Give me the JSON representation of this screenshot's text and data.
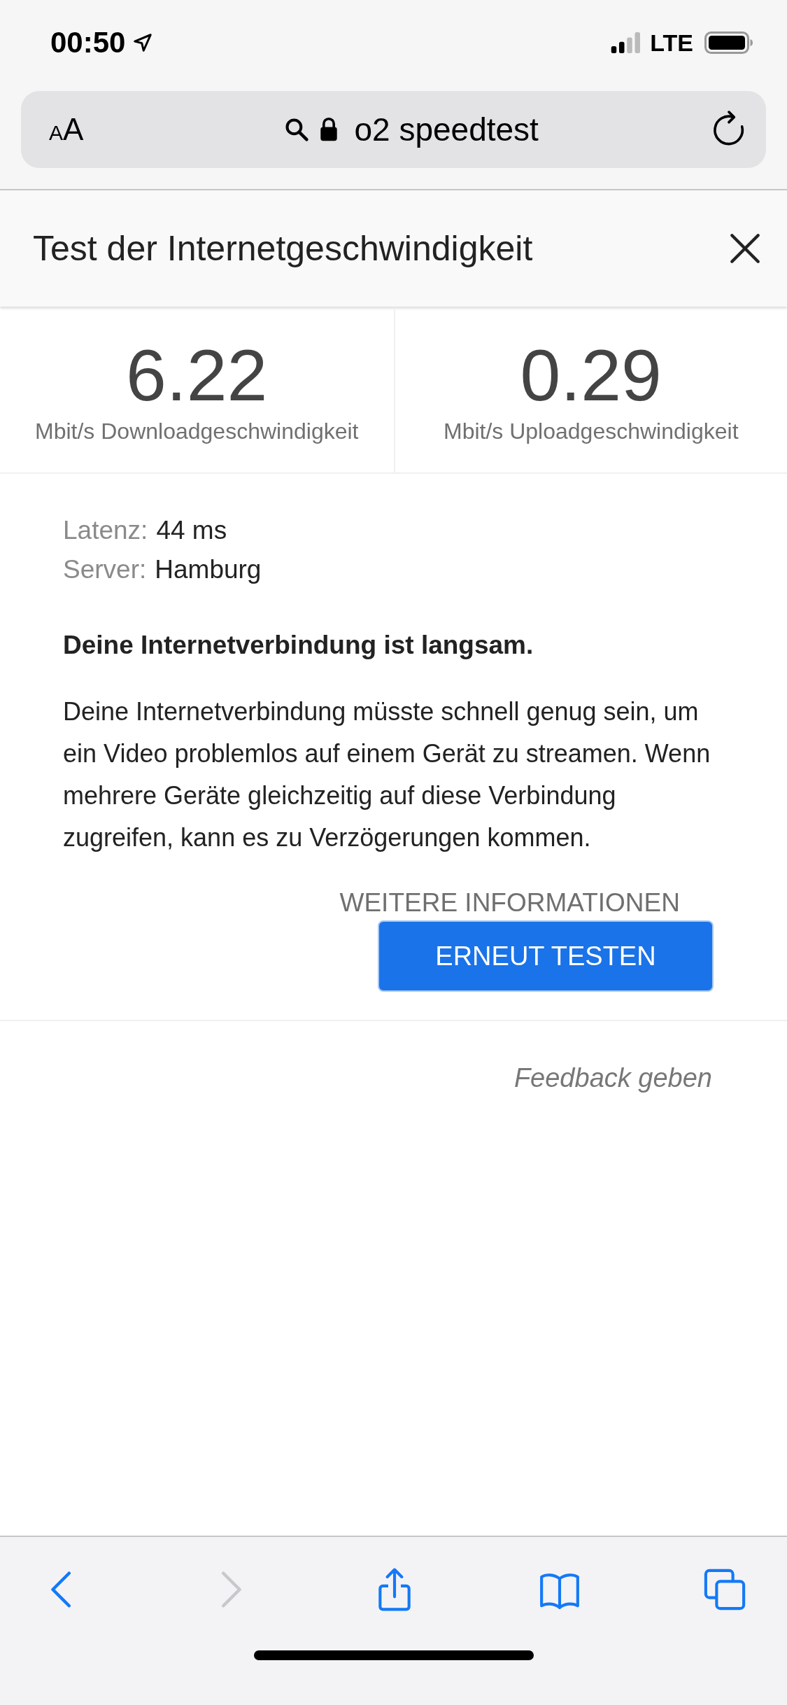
{
  "status_bar": {
    "time": "00:50",
    "network": "LTE"
  },
  "address_bar": {
    "text_size_small": "A",
    "text_size_large": "A",
    "url": "o2 speedtest"
  },
  "panel": {
    "title": "Test der Internetgeschwindigkeit"
  },
  "results": [
    {
      "value": "6.22",
      "label": "Mbit/s Downloadgeschwindigkeit"
    },
    {
      "value": "0.29",
      "label": "Mbit/s Uploadgeschwindigkeit"
    }
  ],
  "details": [
    {
      "label": "Latenz:",
      "value": "44 ms"
    },
    {
      "label": "Server:",
      "value": "Hamburg"
    }
  ],
  "verdict": "Deine Internetverbindung ist langsam.",
  "description": "Deine Internetverbindung müsste schnell genug sein, um ein Video problemlos auf einem Gerät zu streamen. Wenn mehrere Geräte gleichzeitig auf diese Verbindung zugreifen, kann es zu Verzögerungen kommen.",
  "more_link": "WEITERE INFORMATIONEN",
  "retest_button": "ERNEUT TESTEN",
  "feedback_link": "Feedback geben",
  "toolbar": [
    {
      "kind": "back",
      "disabled": false
    },
    {
      "kind": "forward",
      "disabled": true
    },
    {
      "kind": "share",
      "disabled": false
    },
    {
      "kind": "bookmarks",
      "disabled": false
    },
    {
      "kind": "tabs",
      "disabled": false
    }
  ]
}
